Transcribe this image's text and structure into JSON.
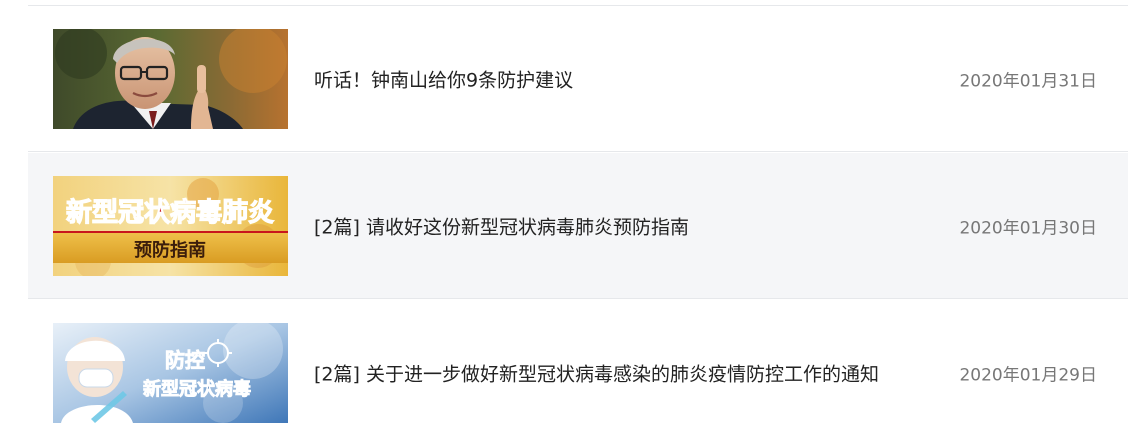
{
  "news_list": {
    "items": [
      {
        "title": "听话！钟南山给你9条防护建议",
        "date": "2020年01月31日"
      },
      {
        "title": "[2篇] 请收好这份新型冠状病毒肺炎预防指南",
        "date": "2020年01月30日",
        "thumbnail": {
          "headline": "新型冠状病毒肺炎",
          "subheadline": "预防指南"
        }
      },
      {
        "title": "[2篇] 关于进一步做好新型冠状病毒感染的肺炎疫情防控工作的通知",
        "date": "2020年01月29日",
        "thumbnail": {
          "line1": "防控",
          "line2": "新型冠状病毒"
        }
      }
    ]
  },
  "colors": {
    "title_text": "#222222",
    "date_text": "#777777",
    "hover_row_bg": "#f5f6f8",
    "divider": "#e6e8eb",
    "banner_red": "#c8161d",
    "banner_gold": "#e9b63a",
    "banner_blue": "#2b63a8"
  }
}
